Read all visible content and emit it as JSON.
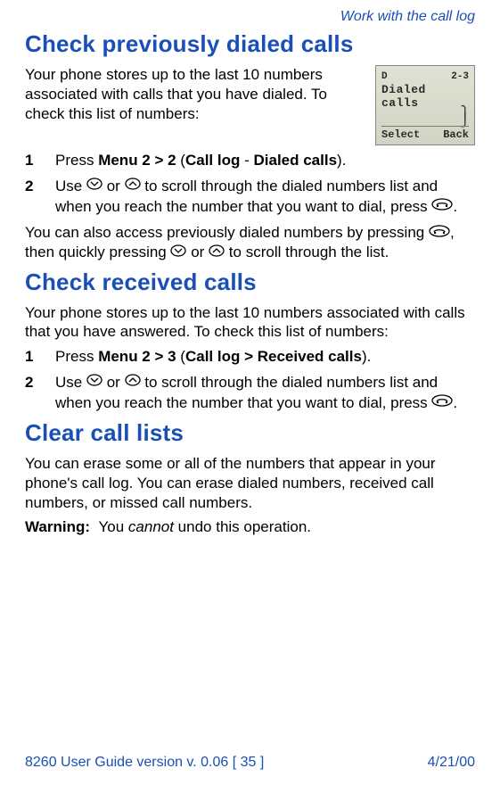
{
  "running_head": "Work with the call log",
  "dialed": {
    "heading": "Check previously dialed calls",
    "intro": "Your phone stores up to the last 10 numbers associated with calls that you have dialed. To check this list of numbers:",
    "step1_pre": "Press ",
    "step1_menu": "Menu 2 > 2",
    "step1_paren_open": " (",
    "step1_calllog": "Call log",
    "step1_dash": " - ",
    "step1_dialed": "Dialed calls",
    "step1_close": ").",
    "step2_a": "Use ",
    "step2_b": " or ",
    "step2_c": " to scroll through the dialed numbers list and when you reach the number that you want to dial, press ",
    "step2_d": ".",
    "after_a": "You can also access previously dialed numbers by pressing ",
    "after_b": ", then quickly pressing ",
    "after_c": " or ",
    "after_d": " to scroll through the list."
  },
  "lcd": {
    "top_left": "D",
    "top_right": "2-3",
    "line": "Dialed calls",
    "bot_left": "Select",
    "bot_right": "Back"
  },
  "received": {
    "heading": "Check received calls",
    "intro": "Your phone stores up to the last 10 numbers associated with calls that you have answered. To check this list of numbers:",
    "step1_pre": "Press ",
    "step1_menu": "Menu 2 > 3",
    "step1_paren_open": " (",
    "step1_calllog": "Call log",
    "step1_gt": " > ",
    "step1_item": "Received calls",
    "step1_close": ").",
    "step2_a": "Use ",
    "step2_b": " or ",
    "step2_c": " to scroll through the dialed numbers list and when you reach the number that you want to dial, press ",
    "step2_d": "."
  },
  "clear": {
    "heading": "Clear call lists",
    "intro": "You can erase some or all of the numbers that appear in your phone's call log. You can erase dialed numbers, received call numbers, or missed call numbers.",
    "warn_label": "Warning:",
    "warn_a": "You ",
    "warn_b": "cannot",
    "warn_c": " undo this operation."
  },
  "footer": {
    "left": "8260 User Guide version v. 0.06 [ 35 ]",
    "right": "4/21/00"
  }
}
